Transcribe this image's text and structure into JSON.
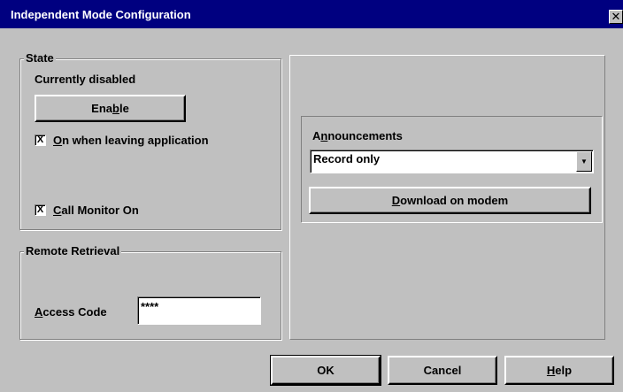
{
  "window": {
    "title": "Independent Mode Configuration",
    "close_glyph": "✕"
  },
  "state": {
    "legend": "State",
    "status_text": "Currently disabled",
    "enable_button": {
      "pre": "Ena",
      "mnemonic": "b",
      "post": "le"
    },
    "on_leaving": {
      "checked": true,
      "mnemonic": "O",
      "rest": "n when leaving application"
    },
    "call_monitor": {
      "checked": true,
      "mnemonic": "C",
      "rest": "all Monitor On"
    }
  },
  "remote": {
    "legend": "Remote Retrieval",
    "access_label": {
      "mnemonic": "A",
      "rest": "ccess Code"
    },
    "access_value": "****"
  },
  "announcements": {
    "label": {
      "pre": "A",
      "mnemonic": "n",
      "post": "nouncements"
    },
    "selected": "Record only",
    "download_button": {
      "mnemonic": "D",
      "rest": "ownload on modem"
    }
  },
  "buttons": {
    "ok": "OK",
    "cancel": "Cancel",
    "help": {
      "mnemonic": "H",
      "rest": "elp"
    }
  },
  "check_glyph": "X"
}
